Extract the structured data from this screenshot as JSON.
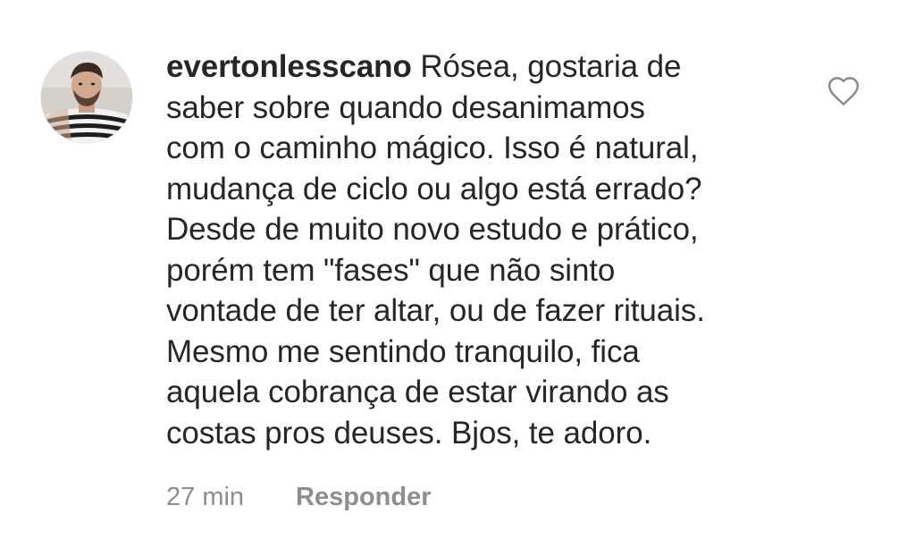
{
  "comment": {
    "avatar_icon": "user-avatar-photo",
    "username": "evertonlesscano",
    "lines": [
      "Rósea, gostaria de",
      "saber sobre quando desanimamos",
      "com o caminho mágico. Isso é natural,",
      "mudança de ciclo ou algo está errado?",
      "Desde de muito novo estudo e prático,",
      "porém tem \"fases\" que não sinto",
      "vontade de ter altar, ou de fazer rituais.",
      "Mesmo me sentindo tranquilo, fica",
      "aquela cobrança de estar virando as",
      "costas pros deuses. Bjos, te adoro."
    ],
    "like_icon": "heart-outline-icon",
    "timestamp": "27 min",
    "reply_label": "Responder"
  },
  "colors": {
    "text": "#262626",
    "secondary": "#8e8e8e",
    "background": "#ffffff"
  }
}
